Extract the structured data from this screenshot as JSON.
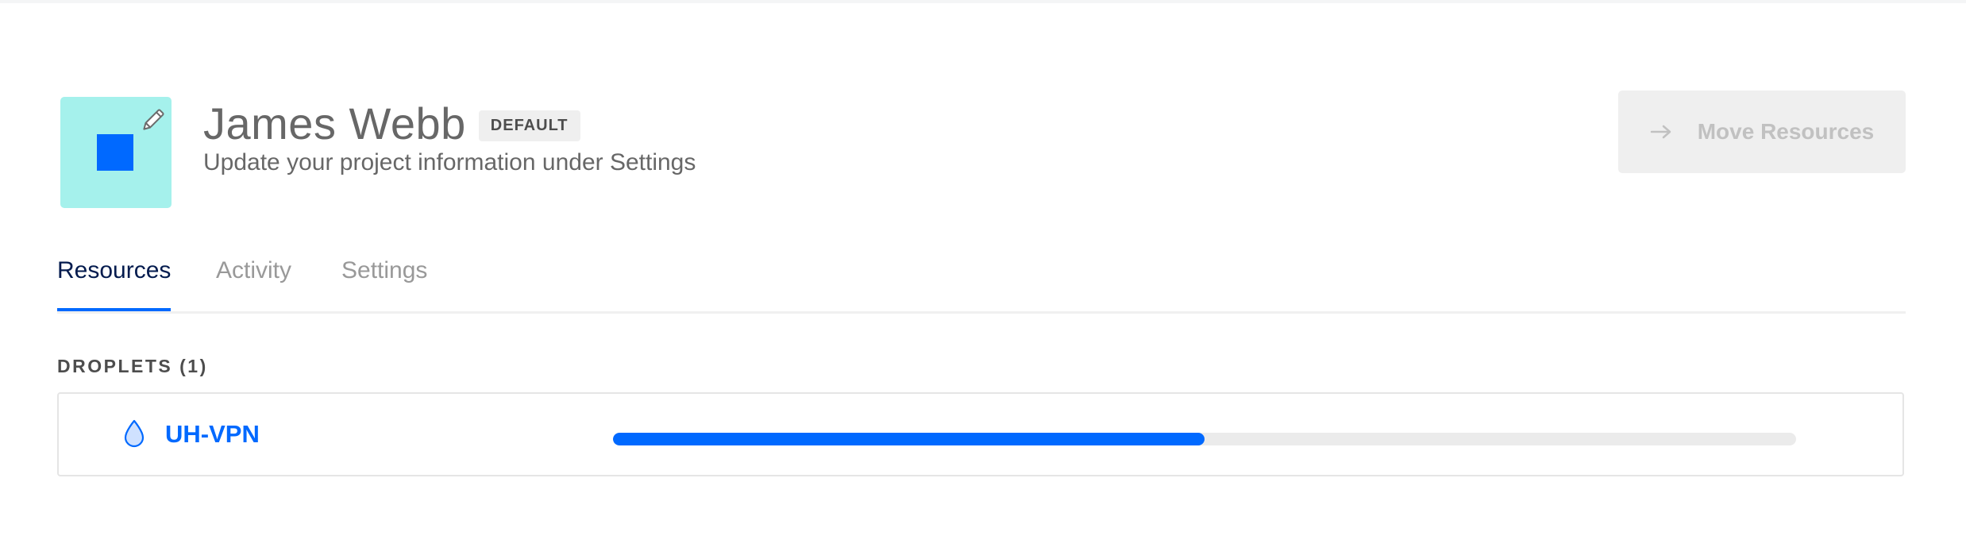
{
  "project": {
    "name": "James Webb",
    "badge": "DEFAULT",
    "subtitle": "Update your project information under Settings",
    "avatar_icon": "pencil-icon",
    "avatar_color": "#a5f1ec",
    "avatar_square_color": "#0069ff"
  },
  "actions": {
    "move_resources_label": "Move Resources",
    "move_resources_icon": "arrow-right-icon",
    "move_resources_disabled": true
  },
  "tabs": [
    {
      "label": "Resources",
      "active": true
    },
    {
      "label": "Activity",
      "active": false
    },
    {
      "label": "Settings",
      "active": false
    }
  ],
  "droplets": {
    "section_label": "DROPLETS (1)",
    "items": [
      {
        "name": "UH-VPN",
        "icon": "droplet-icon",
        "progress_fraction": 0.5
      }
    ]
  },
  "colors": {
    "accent": "#0069ff",
    "active_tab_text": "#031b4e"
  }
}
